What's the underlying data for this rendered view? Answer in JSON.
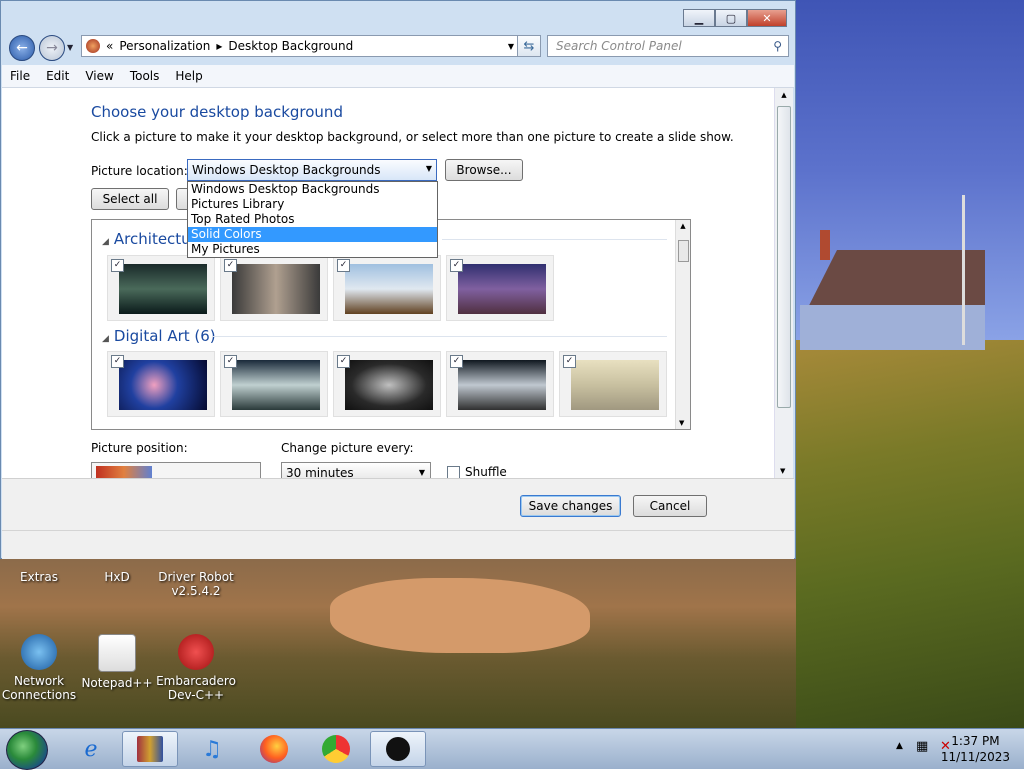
{
  "window": {
    "breadcrumb": {
      "root": "«",
      "segments": [
        "Personalization",
        "Desktop Background"
      ]
    },
    "search_placeholder": "Search Control Panel",
    "menu": [
      "File",
      "Edit",
      "View",
      "Tools",
      "Help"
    ],
    "heading": "Choose your desktop background",
    "description": "Click a picture to make it your desktop background, or select more than one picture to create a slide show.",
    "picture_location_label": "Picture location:",
    "picture_location_value": "Windows Desktop Backgrounds",
    "browse_label": "Browse...",
    "select_all_label": "Select all",
    "location_options": [
      "Windows Desktop Backgrounds",
      "Pictures Library",
      "Top Rated Photos",
      "Solid Colors",
      "My Pictures"
    ],
    "highlighted_option": "Solid Colors",
    "groups": [
      {
        "title": "Architecture",
        "count": 4
      },
      {
        "title": "Digital Art (6)",
        "count": 5
      }
    ],
    "picture_position_label": "Picture position:",
    "change_every_label": "Change picture every:",
    "change_every_value": "30 minutes",
    "shuffle_label": "Shuffle",
    "save_label": "Save changes",
    "cancel_label": "Cancel"
  },
  "desktop_icons": [
    {
      "name": "Extras",
      "label": "Extras"
    },
    {
      "name": "hxd",
      "label": "HxD"
    },
    {
      "name": "driver-robot",
      "label": "Driver Robot v2.5.4.2"
    },
    {
      "name": "network-connections",
      "label": "Network Connections"
    },
    {
      "name": "notepad-plus-plus",
      "label": "Notepad++"
    },
    {
      "name": "embarcadero-dev-cpp",
      "label": "Embarcadero Dev-C++"
    }
  ],
  "taskbar": {
    "items": [
      "winrar-icon",
      "ie-icon",
      "itunes-icon",
      "firefox-icon",
      "chrome-icon",
      "personalization-icon"
    ],
    "time": "1:37 PM",
    "date": "11/11/2023"
  },
  "colors": {
    "accent": "#1a4aa0",
    "highlight": "#3399ff"
  }
}
